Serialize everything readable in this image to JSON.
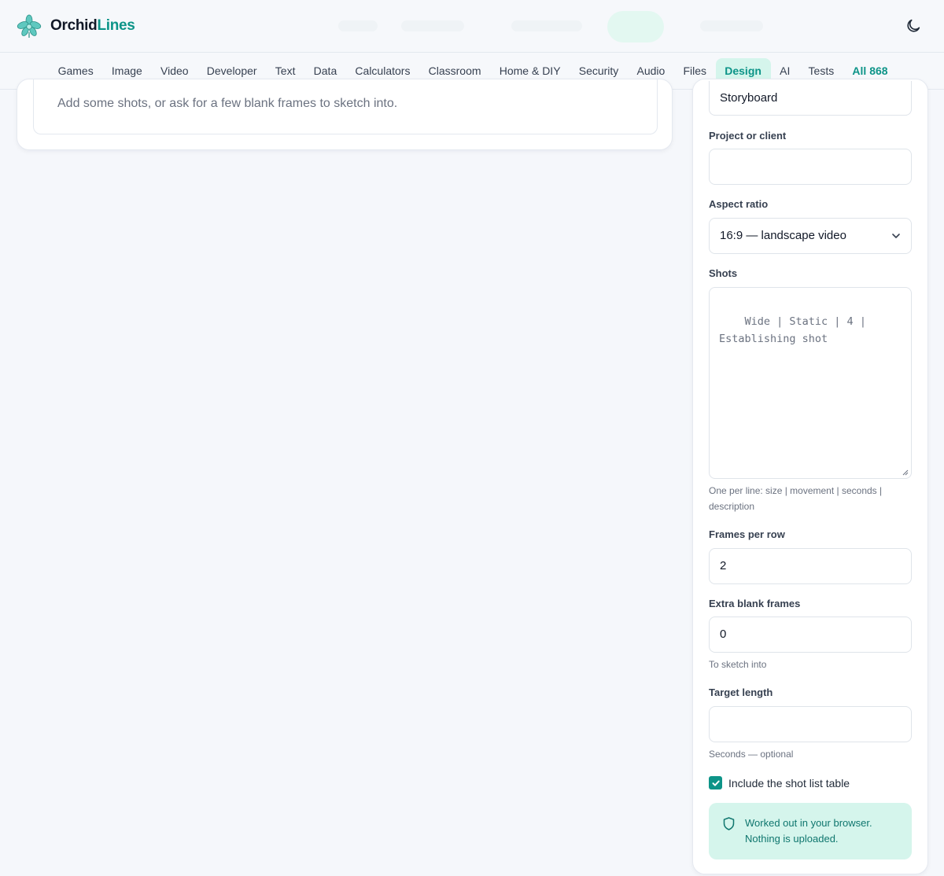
{
  "brand": {
    "name_part1": "Orchid",
    "name_part2": "Lines"
  },
  "header": {
    "theme_toggle_icon": "moon-icon"
  },
  "nav": {
    "items": [
      {
        "label": "Games"
      },
      {
        "label": "Image"
      },
      {
        "label": "Video"
      },
      {
        "label": "Developer"
      },
      {
        "label": "Text"
      },
      {
        "label": "Data"
      },
      {
        "label": "Calculators"
      },
      {
        "label": "Classroom"
      },
      {
        "label": "Home & DIY"
      },
      {
        "label": "Security"
      },
      {
        "label": "Audio"
      },
      {
        "label": "Files"
      },
      {
        "label": "Design"
      },
      {
        "label": "AI"
      },
      {
        "label": "Tests"
      },
      {
        "label": "All 868"
      }
    ],
    "active": "Design"
  },
  "main": {
    "empty_message": "Add some shots, or ask for a few blank frames to sketch into."
  },
  "form": {
    "title_value": "Storyboard",
    "project_label": "Project or client",
    "project_value": "",
    "aspect_label": "Aspect ratio",
    "aspect_value": "16:9 — landscape video",
    "shots_label": "Shots",
    "shots_placeholder": "Wide | Static | 4 |\nEstablishing shot",
    "shots_hint": "One per line: size | movement | seconds | description",
    "frames_label": "Frames per row",
    "frames_value": "2",
    "extra_label": "Extra blank frames",
    "extra_value": "0",
    "extra_hint": "To sketch into",
    "target_label": "Target length",
    "target_value": "",
    "target_hint": "Seconds — optional",
    "include_table_label": "Include the shot list table",
    "include_table_checked": true,
    "notice": "Worked out in your browser. Nothing is uploaded."
  },
  "colors": {
    "accent": "#0d9488",
    "accent_soft": "#d5f5ec"
  }
}
